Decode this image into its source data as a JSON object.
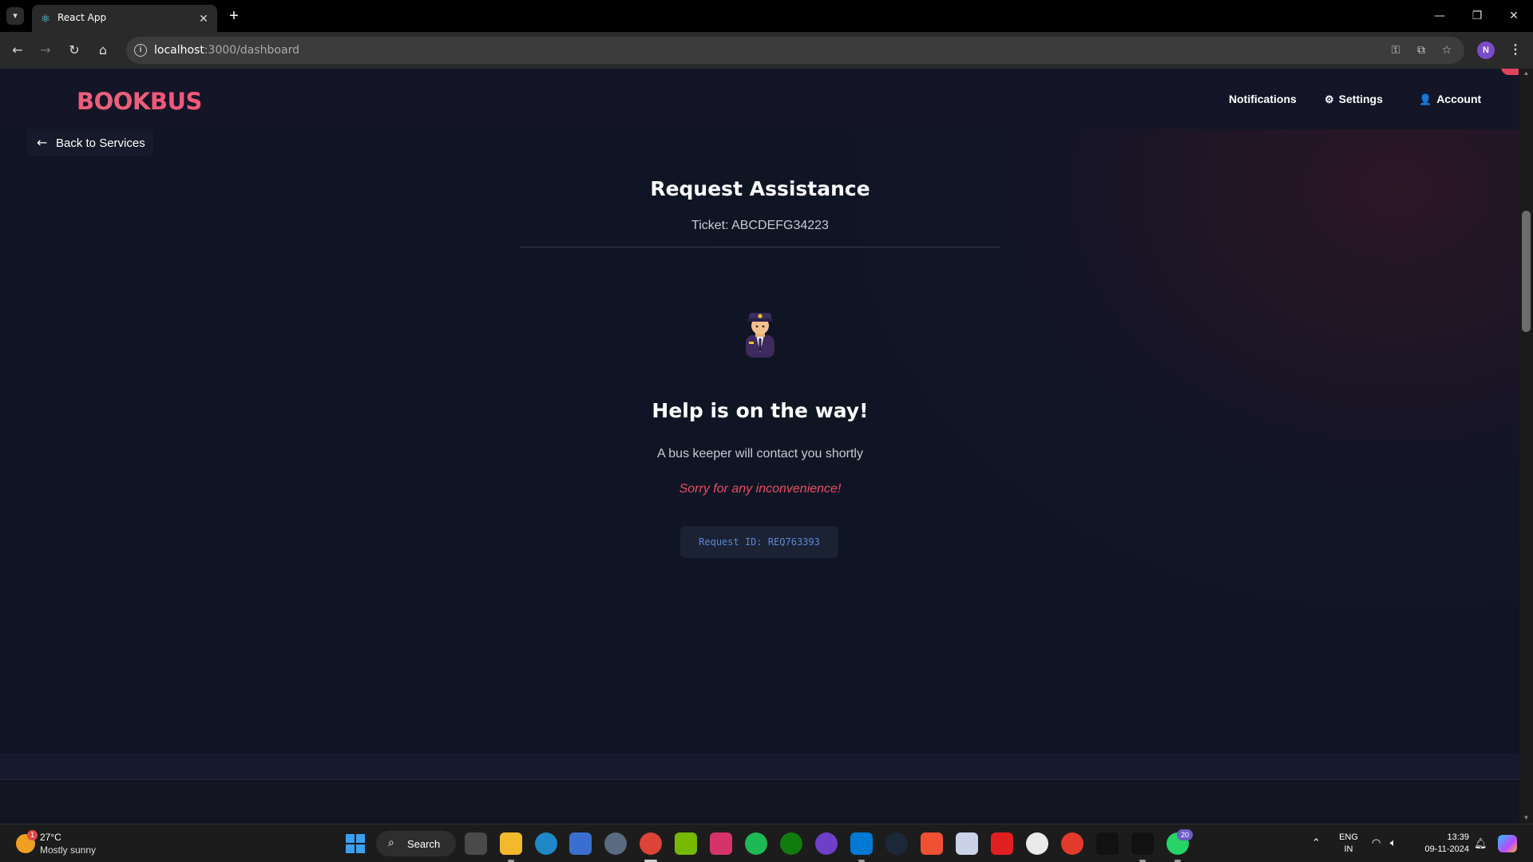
{
  "browser": {
    "tab_title": "React App",
    "url_host": "localhost",
    "url_rest": ":3000/dashboard",
    "profile_initial": "N"
  },
  "app": {
    "brand_part1": "BOOK",
    "brand_part2": "BUS",
    "nav": {
      "notifications": "Notifications",
      "settings": "Settings",
      "account": "Account"
    },
    "back_label": "Back to Services",
    "heading": "Request Assistance",
    "ticket": "Ticket: ABCDEFG34223",
    "help_title": "Help is on the way!",
    "help_subtitle": "A bus keeper will contact you shortly",
    "apology": "Sorry for any inconvenience!",
    "request_id": "Request ID: REQ763393"
  },
  "taskbar": {
    "weather_badge": "1",
    "temperature": "27°C",
    "weather": "Mostly sunny",
    "search_label": "Search",
    "whatsapp_badge": "20",
    "lang_line1": "ENG",
    "lang_line2": "IN",
    "time": "13:39",
    "date": "09-11-2024"
  },
  "colors": {
    "brand": "#e8607a",
    "apology": "#ef4a63",
    "request_id": "#5b88d6"
  }
}
